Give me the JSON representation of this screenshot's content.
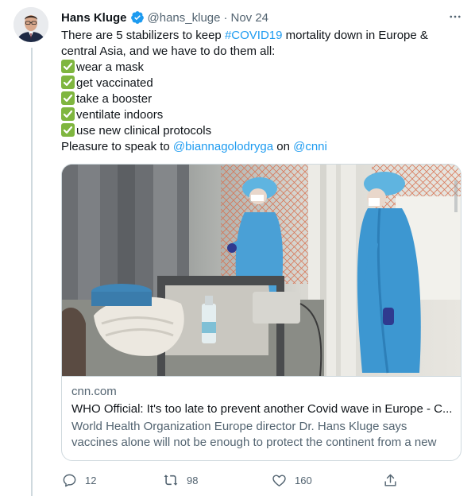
{
  "tweet": {
    "author_name": "Hans Kluge",
    "handle": "@hans_kluge",
    "separator": "·",
    "date": "Nov 24",
    "verified_icon": "verified-badge-icon",
    "text": {
      "intro_before_hashtag": "There are 5 stabilizers to keep ",
      "hashtag": "#COVID19",
      "intro_after_hashtag": " mortality down in Europe &",
      "intro_line2": "central Asia, and we have to do them all:",
      "items": [
        "wear a mask",
        "get vaccinated",
        "take a booster",
        "ventilate indoors",
        "use new clinical protocols"
      ],
      "closing_prefix": "Pleasure to speak to ",
      "mention_1": "@biannagolodryga",
      "closing_mid": " on ",
      "mention_2": "@cnni"
    },
    "card": {
      "domain": "cnn.com",
      "title": "WHO Official: It's too late to prevent another Covid wave in Europe - C...",
      "description": "World Health Organization Europe director Dr. Hans Kluge says vaccines alone will not be enough to protect the continent from a new wave of ..."
    },
    "actions": {
      "reply_count": "12",
      "retweet_count": "98",
      "like_count": "160"
    }
  },
  "colors": {
    "accent": "#1d9bf0",
    "secondary_text": "#536471",
    "primary_text": "#0f1419",
    "border": "#cfd9de",
    "check_green": "#7fb63f",
    "scrubs_blue": "#4aa0d6"
  }
}
